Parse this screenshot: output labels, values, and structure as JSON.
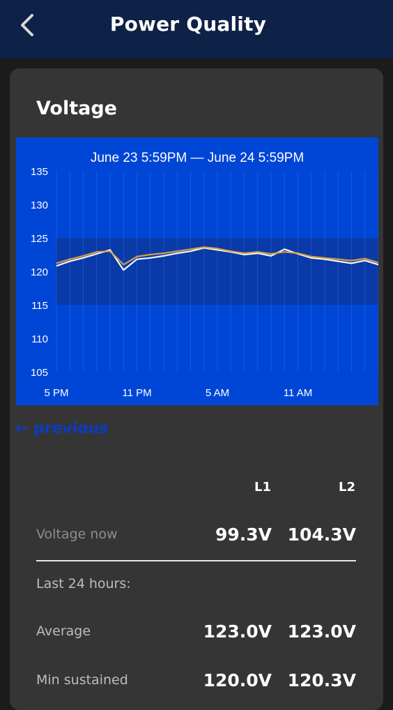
{
  "header": {
    "title": "Power Quality",
    "back_icon": "chevron-left-icon"
  },
  "card": {
    "title": "Voltage",
    "previous_label": "← previous",
    "columns": [
      "L1",
      "L2"
    ],
    "rows": [
      {
        "label": "Voltage now",
        "l1": "99.3V",
        "l2": "104.3V"
      },
      {
        "label": "Last 24 hours:"
      },
      {
        "label": "Average",
        "l1": "123.0V",
        "l2": "123.0V"
      },
      {
        "label": "Min sustained",
        "l1": "120.0V",
        "l2": "120.3V"
      }
    ]
  },
  "chart_data": {
    "type": "line",
    "title": "June 23  5:59PM  —  June 24  5:59PM",
    "y_ticks": [
      "135",
      "130",
      "125",
      "120",
      "115",
      "110",
      "105"
    ],
    "x_ticks": [
      "5 PM",
      "11 PM",
      "5 AM",
      "11 AM"
    ],
    "ylim": [
      105,
      135
    ],
    "normal_band": [
      115,
      125
    ],
    "colors": {
      "background": "#0046d6",
      "band": "#0a3aa8",
      "L1": "#ffffff",
      "L2": "#e0a43a"
    },
    "x_hours": [
      0,
      1,
      2,
      3,
      4,
      5,
      6,
      7,
      8,
      9,
      10,
      11,
      12,
      13,
      14,
      15,
      16,
      17,
      18,
      19,
      20,
      21,
      22,
      23,
      24
    ],
    "series": [
      {
        "values": [
          120.8,
          121.5,
          122.0,
          122.6,
          123.2,
          120.2,
          121.8,
          122.0,
          122.3,
          122.7,
          123.0,
          123.5,
          123.2,
          122.9,
          122.5,
          122.7,
          122.3,
          123.3,
          122.6,
          122.0,
          121.8,
          121.5,
          121.2,
          121.6,
          121.0
        ]
      },
      {
        "values": [
          121.2,
          121.8,
          122.3,
          122.9,
          123.0,
          121.0,
          122.2,
          122.5,
          122.7,
          123.0,
          123.3,
          123.6,
          123.4,
          123.0,
          122.7,
          122.9,
          122.6,
          122.9,
          122.7,
          122.2,
          122.0,
          121.8,
          121.6,
          121.9,
          121.3
        ]
      }
    ]
  }
}
